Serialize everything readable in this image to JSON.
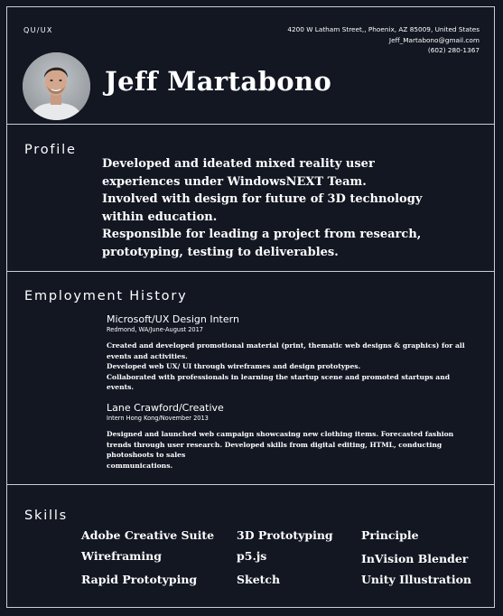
{
  "header": {
    "tag": "QU/UX",
    "contact": {
      "address": "4200 W Latham Street,, Phoenix, AZ 85009, United States",
      "email": "Jeff_Martabono@gmail.com",
      "phone": "(602) 280-1367"
    },
    "name": "Jeff  Martabono"
  },
  "profile": {
    "title": "Profile",
    "lines": [
      " Developed and ideated mixed reality user",
      "experiences under WindowsNEXT Team.",
      "Involved with design for future of 3D technology",
      "within education.",
      "Responsible for leading a project from research,",
      "prototyping, testing to deliverables."
    ]
  },
  "employment": {
    "title": "Employment History",
    "jobs": [
      {
        "title": "Microsoft/UX Design Intern",
        "sub": "Redmond, WA/June-August 2017",
        "desc": [
          " Created and developed promotional material (print, thematic web designs & graphics) for all",
          "events and activities.",
          "Developed web UX/ UI through wireframes and design prototypes.",
          "Collaborated with professionals in learning the startup scene and promoted startups and",
          "events."
        ]
      },
      {
        "title": "Lane Crawford/Creative",
        "sub": "Intern Hong Kong/November 2013",
        "desc": [
          "Designed and launched web campaign showcasing new clothing items. Forecasted fashion",
          "trends through user research. Developed skills from digital editing, HTML, conducting",
          "photoshoots to sales",
          "communications."
        ]
      }
    ]
  },
  "skills": {
    "title": "Skills",
    "col1": [
      "Adobe Creative Suite",
      "Wireframing",
      "Rapid Prototyping"
    ],
    "col2": [
      "3D Prototyping",
      "p5.js",
      "Sketch"
    ],
    "col3": [
      "Principle",
      "InVision Blender",
      "Unity Illustration"
    ]
  },
  "colors": {
    "background": "#121722",
    "rule": "#c9cdd6",
    "text": "#ffffff"
  },
  "icons": {
    "avatar": "profile-photo"
  }
}
